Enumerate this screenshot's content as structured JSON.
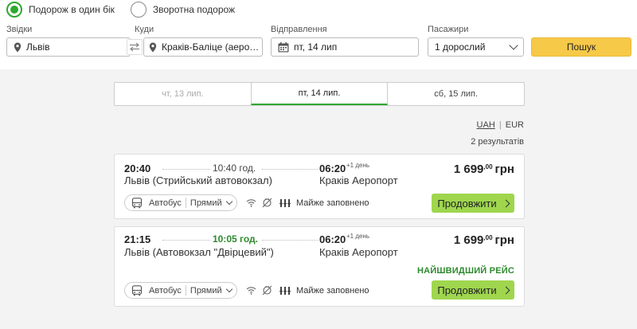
{
  "trip_type": {
    "one_way": "Подорож в один бік",
    "round_trip": "Зворотна подорож"
  },
  "search": {
    "from_label": "Звідки",
    "from_value": "Львів",
    "to_label": "Куди",
    "to_value": "Краків-Баліце (аеропорт)",
    "departure_label": "Відправлення",
    "departure_value": "пт, 14 лип",
    "passengers_label": "Пасажири",
    "passengers_value": "1 дорослий",
    "search_button": "Пошук"
  },
  "dates": [
    {
      "label": "чт, 13 лип.",
      "state": "disabled"
    },
    {
      "label": "пт, 14 лип.",
      "state": "active"
    },
    {
      "label": "сб, 15 лип.",
      "state": "normal"
    }
  ],
  "currency": {
    "active": "UAH",
    "separator": "|",
    "other": "EUR"
  },
  "results_count": "2 результатів",
  "results": [
    {
      "dep_time": "20:40",
      "duration": "10:40 год.",
      "arr_time": "06:20",
      "next_day": "+1 день",
      "dep_station": "Львів (Стрийський автовокзал)",
      "arr_station": "Краків Аеропорт",
      "price_main": "1 699",
      "price_cents": ",00",
      "price_currency": "грн",
      "transport": "Автобус",
      "route_type": "Прямий",
      "occupancy": "Майже заповнено",
      "cta": "Продовжити",
      "badge": ""
    },
    {
      "dep_time": "21:15",
      "duration": "10:05 год.",
      "arr_time": "06:20",
      "next_day": "+1 день",
      "dep_station": "Львів (Автовокзал \"Двірцевий\")",
      "arr_station": "Краків Аеропорт",
      "price_main": "1 699",
      "price_cents": ",00",
      "price_currency": "грн",
      "transport": "Автобус",
      "route_type": "Прямий",
      "occupancy": "Майже заповнено",
      "cta": "Продовжити",
      "badge": "НАЙШВИДШИЙ РЕЙС"
    }
  ],
  "colors": {
    "accent_green": "#2ea82e",
    "cta_green": "#9fd64e",
    "search_yellow": "#f7c948"
  },
  "icons": {
    "pin": "map-pin-icon",
    "swap": "swap-icon",
    "calendar": "calendar-icon",
    "bus": "bus-icon",
    "wifi": "wifi-icon",
    "socket": "power-socket-icon",
    "seats": "seats-icon"
  }
}
